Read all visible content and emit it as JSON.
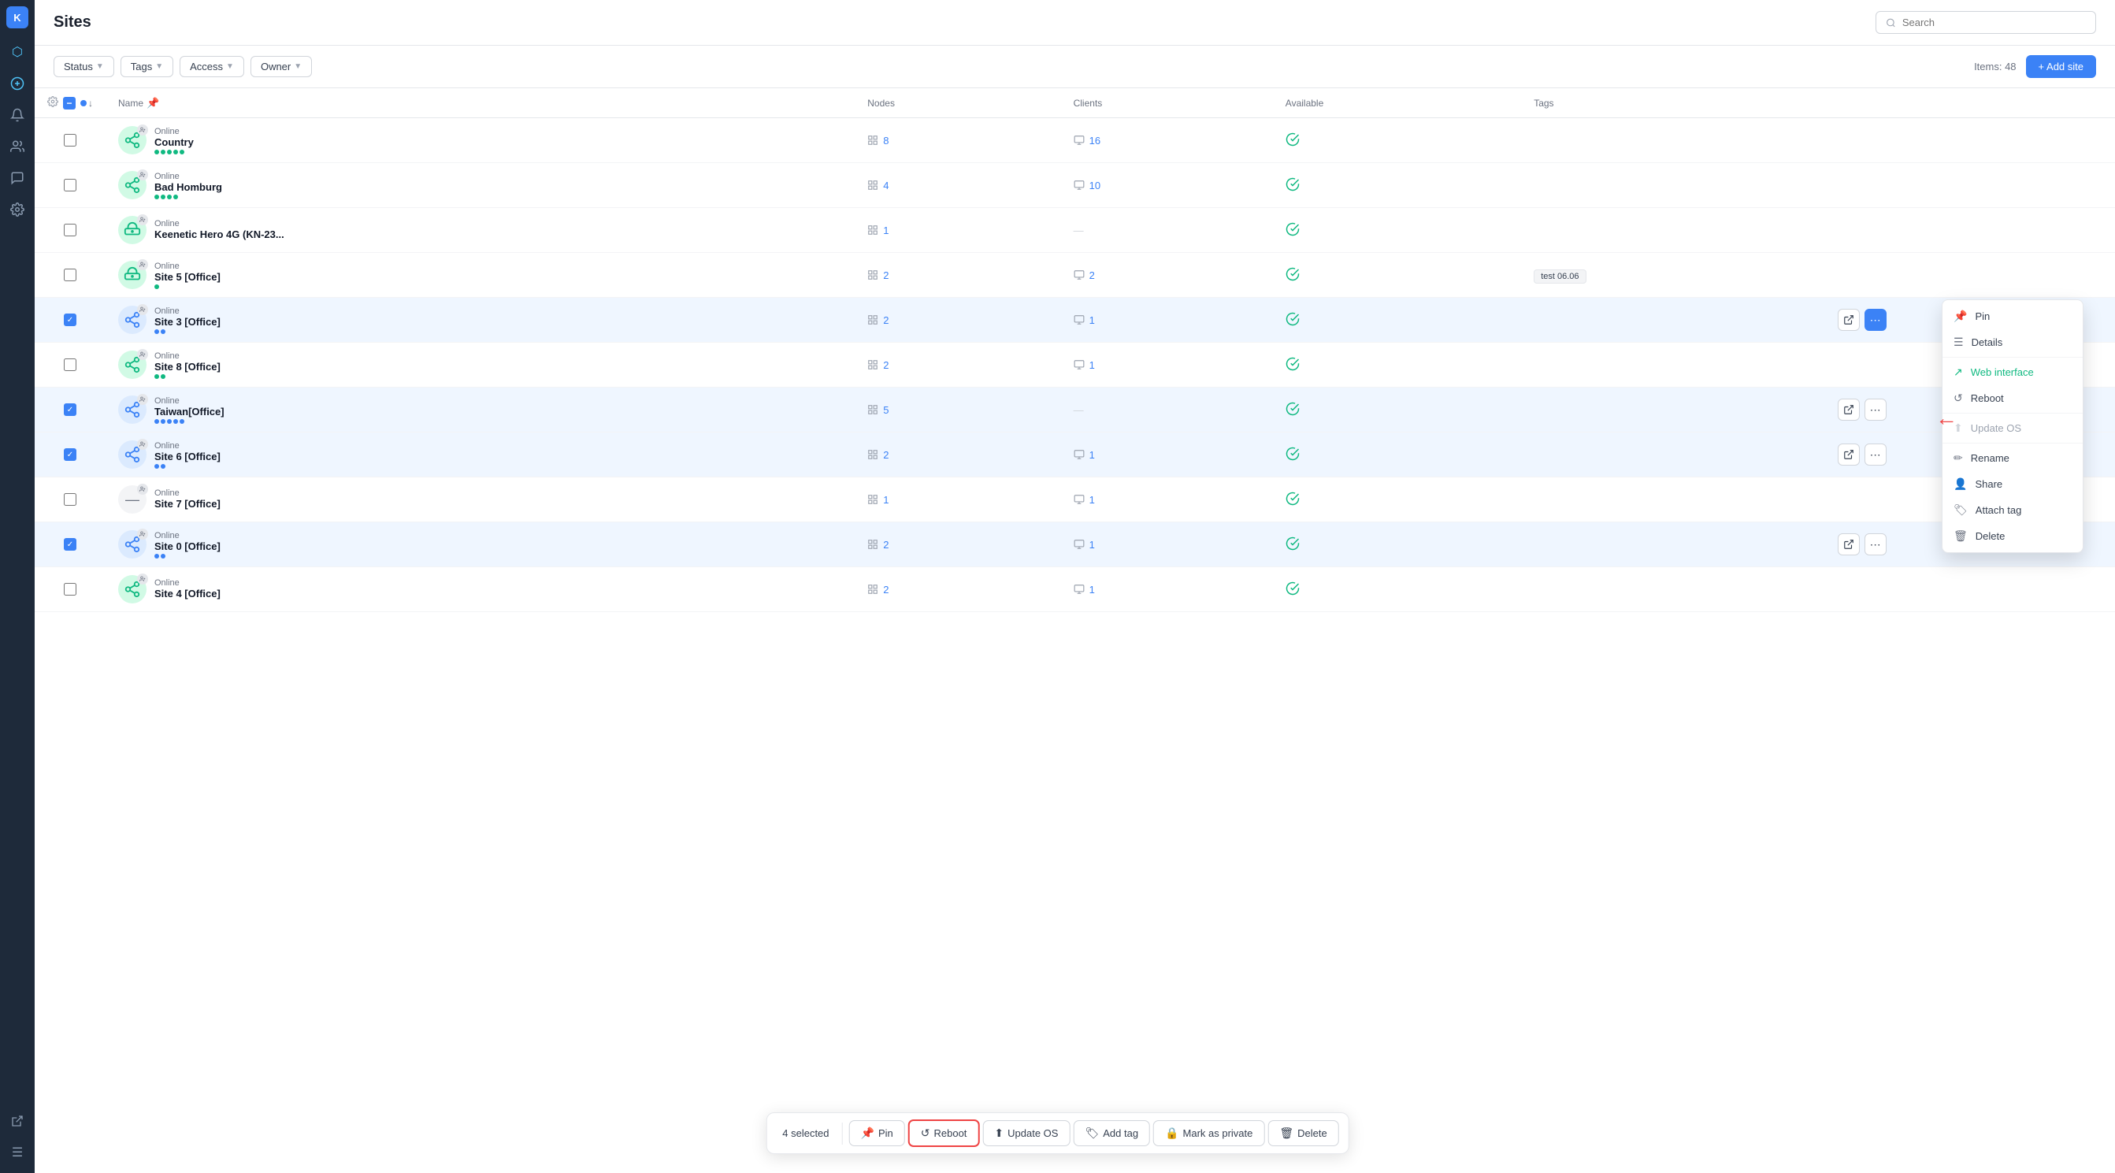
{
  "app": {
    "title": "Sites",
    "search_placeholder": "Search"
  },
  "sidebar": {
    "logo_text": "K",
    "icons": [
      {
        "name": "topology-icon",
        "symbol": "⬡",
        "active": false
      },
      {
        "name": "vpn-icon",
        "symbol": "⟳",
        "active": true
      },
      {
        "name": "bell-icon",
        "symbol": "🔔",
        "active": false
      },
      {
        "name": "users-icon",
        "symbol": "👥",
        "active": false
      },
      {
        "name": "chat-icon",
        "symbol": "💬",
        "active": false
      },
      {
        "name": "settings-icon",
        "symbol": "⚙",
        "active": false
      },
      {
        "name": "export-icon",
        "symbol": "↗",
        "active": false
      }
    ]
  },
  "toolbar": {
    "filters": [
      {
        "label": "Status",
        "name": "status-filter"
      },
      {
        "label": "Tags",
        "name": "tags-filter"
      },
      {
        "label": "Access",
        "name": "access-filter"
      },
      {
        "label": "Owner",
        "name": "owner-filter"
      }
    ],
    "items_count": "Items: 48",
    "add_btn": "+ Add site"
  },
  "table": {
    "columns": [
      "Name",
      "Nodes",
      "Clients",
      "Available",
      "Tags"
    ],
    "rows": [
      {
        "id": 1,
        "selected": false,
        "icon_type": "share-green",
        "status": "Online",
        "name": "Country",
        "nodes": "8",
        "clients": "16",
        "available": true,
        "tags": "",
        "dots": [
          "green",
          "green",
          "green",
          "green",
          "green"
        ]
      },
      {
        "id": 2,
        "selected": false,
        "icon_type": "share-green",
        "status": "Online",
        "name": "Bad Homburg",
        "nodes": "4",
        "clients": "10",
        "available": true,
        "tags": "",
        "dots": [
          "green",
          "green",
          "green",
          "green"
        ]
      },
      {
        "id": 3,
        "selected": false,
        "icon_type": "router-green",
        "status": "Online",
        "name": "Keenetic Hero 4G (KN-23...",
        "nodes": "1",
        "clients": "",
        "available": true,
        "tags": "",
        "dots": []
      },
      {
        "id": 4,
        "selected": false,
        "icon_type": "router-green",
        "status": "Online",
        "name": "Site 5 [Office]",
        "nodes": "2",
        "clients": "2",
        "available": true,
        "tags": "test 06.06",
        "dots": [
          "green"
        ]
      },
      {
        "id": 5,
        "selected": true,
        "icon_type": "share-blue",
        "status": "Online",
        "name": "Site 3 [Office]",
        "nodes": "2",
        "clients": "1",
        "available": true,
        "tags": "",
        "dots": [
          "blue",
          "blue"
        ],
        "context_menu": true
      },
      {
        "id": 6,
        "selected": false,
        "icon_type": "share-green",
        "status": "Online",
        "name": "Site 8 [Office]",
        "nodes": "2",
        "clients": "1",
        "available": true,
        "tags": "",
        "dots": [
          "green",
          "green"
        ]
      },
      {
        "id": 7,
        "selected": true,
        "icon_type": "share-blue",
        "status": "Online",
        "name": "Taiwan[Office]",
        "nodes": "5",
        "clients": "",
        "available": true,
        "tags": "",
        "dots": [
          "blue",
          "blue",
          "blue",
          "blue",
          "blue"
        ]
      },
      {
        "id": 8,
        "selected": true,
        "icon_type": "share-blue",
        "status": "Online",
        "name": "Site 6 [Office]",
        "nodes": "2",
        "clients": "1",
        "available": true,
        "tags": "",
        "dots": [
          "blue",
          "blue"
        ]
      },
      {
        "id": 9,
        "selected": false,
        "icon_type": "minus-green",
        "status": "Online",
        "name": "Site 7 [Office]",
        "nodes": "1",
        "clients": "1",
        "available": true,
        "tags": "",
        "dots": []
      },
      {
        "id": 10,
        "selected": true,
        "icon_type": "share-blue",
        "status": "Online",
        "name": "Site 0 [Office]",
        "nodes": "2",
        "clients": "1",
        "available": true,
        "tags": "",
        "dots": [
          "blue",
          "blue"
        ]
      },
      {
        "id": 11,
        "selected": false,
        "icon_type": "share-green",
        "status": "Online",
        "name": "Site 4 [Office]",
        "nodes": "2",
        "clients": "1",
        "available": true,
        "tags": "",
        "dots": []
      }
    ]
  },
  "context_menu": {
    "items": [
      {
        "label": "Pin",
        "icon": "📌",
        "disabled": false,
        "class": ""
      },
      {
        "label": "Details",
        "icon": "☰",
        "disabled": false,
        "class": ""
      },
      {
        "label": "Web interface",
        "icon": "↗",
        "disabled": false,
        "class": "green"
      },
      {
        "label": "Reboot",
        "icon": "↺",
        "disabled": false,
        "class": ""
      },
      {
        "label": "Update OS",
        "icon": "⬆",
        "disabled": true,
        "class": "disabled"
      },
      {
        "label": "Rename",
        "icon": "✏",
        "disabled": false,
        "class": ""
      },
      {
        "label": "Share",
        "icon": "👤",
        "disabled": false,
        "class": ""
      },
      {
        "label": "Attach tag",
        "icon": "🏷",
        "disabled": false,
        "class": ""
      },
      {
        "label": "Delete",
        "icon": "🗑",
        "disabled": false,
        "class": ""
      }
    ]
  },
  "bottom_bar": {
    "selected_count": "4 selected",
    "buttons": [
      {
        "label": "Pin",
        "icon": "📌",
        "name": "pin-btn",
        "highlighted": false
      },
      {
        "label": "Reboot",
        "icon": "↺",
        "name": "reboot-btn",
        "highlighted": true
      },
      {
        "label": "Update OS",
        "icon": "⬆",
        "name": "update-os-btn",
        "highlighted": false
      },
      {
        "label": "Add tag",
        "icon": "🏷",
        "name": "add-tag-btn",
        "highlighted": false
      },
      {
        "label": "Mark as private",
        "icon": "🔒",
        "name": "mark-private-btn",
        "highlighted": false
      },
      {
        "label": "Delete",
        "icon": "🗑",
        "name": "delete-btn",
        "highlighted": false
      }
    ]
  }
}
